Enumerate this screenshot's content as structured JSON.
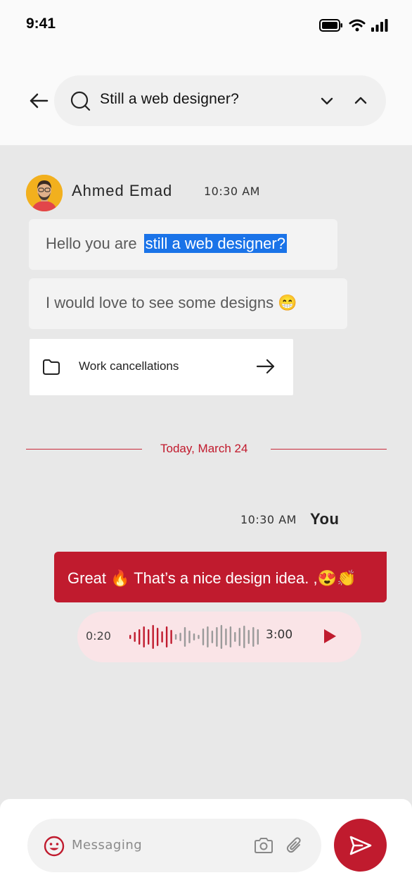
{
  "status_bar": {
    "time": "9:41"
  },
  "search": {
    "query": "Still a web designer?"
  },
  "messages": {
    "incoming": {
      "sender": "Ahmed Emad",
      "time": "10:30 AM",
      "bubble1_prefix": "Hello you are",
      "bubble1_highlight": "still a web designer?",
      "bubble2": "I would love to see some designs 😁",
      "file_label": "Work cancellations"
    },
    "date_divider": "Today, March 24",
    "outgoing": {
      "time": "10:30 AM",
      "sender": "You",
      "text": "Great 🔥 That’s a nice design idea. ,😍👏",
      "voice_elapsed": "0:20",
      "voice_total": "3:00",
      "voice_progress": 0.11
    }
  },
  "composer": {
    "placeholder": "Messaging"
  },
  "colors": {
    "accent": "#c01b2e",
    "highlight": "#1a73e8",
    "chat_bg": "#e8e8e8",
    "voice_bg": "#fae4e7"
  }
}
